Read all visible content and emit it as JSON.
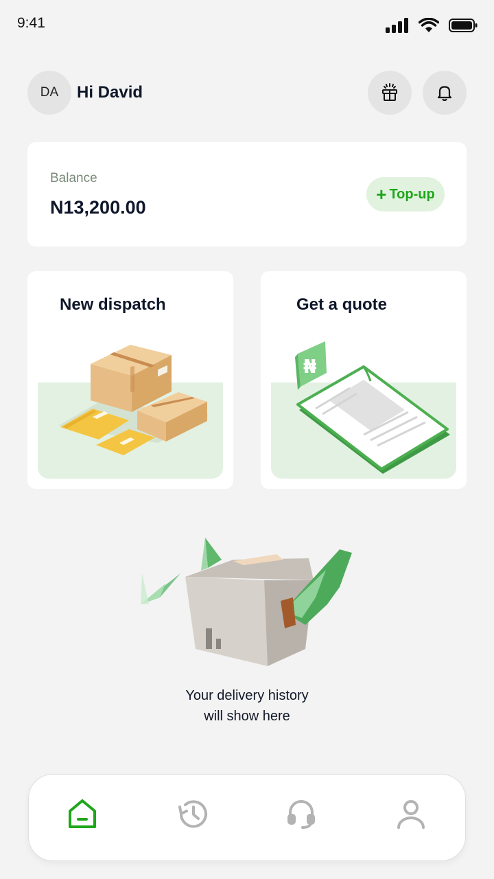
{
  "status_bar": {
    "time": "9:41"
  },
  "header": {
    "avatar_initials": "DA",
    "greeting": "Hi David"
  },
  "balance": {
    "label": "Balance",
    "amount": "N13,200.00",
    "topup_label": "Top-up"
  },
  "actions": [
    {
      "label": "New dispatch"
    },
    {
      "label": "Get a quote"
    }
  ],
  "empty_state": {
    "line1": "Your delivery history",
    "line2": "will show here"
  },
  "colors": {
    "accent": "#1fa61b",
    "accent_bg": "#e1f2df",
    "background": "#f3f3f3"
  },
  "nav": {
    "items": [
      {
        "icon": "home-icon",
        "active": true
      },
      {
        "icon": "history-icon",
        "active": false
      },
      {
        "icon": "headset-icon",
        "active": false
      },
      {
        "icon": "profile-icon",
        "active": false
      }
    ]
  }
}
